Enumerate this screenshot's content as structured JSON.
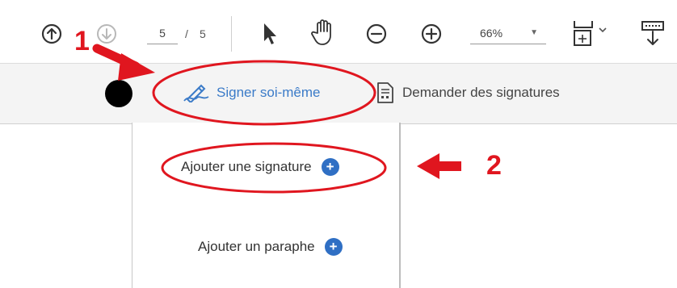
{
  "toolbar": {
    "current_page": "5",
    "page_separator": "/",
    "total_pages": "5",
    "zoom_value": "66%",
    "icons": [
      "arrow-up-circle-icon",
      "arrow-down-circle-icon",
      "select-arrow-icon",
      "hand-tool-icon",
      "zoom-out-icon",
      "zoom-in-icon",
      "fit-page-icon",
      "print-icon"
    ]
  },
  "signbar": {
    "sign_self_label": "Signer soi-même",
    "request_signatures_label": "Demander des signatures"
  },
  "menu": {
    "add_signature_label": "Ajouter une signature",
    "add_initials_label": "Ajouter un paraphe",
    "plus_glyph": "+"
  },
  "annotations": {
    "step_1": "1",
    "step_2": "2",
    "accent_color": "#e0161f"
  }
}
